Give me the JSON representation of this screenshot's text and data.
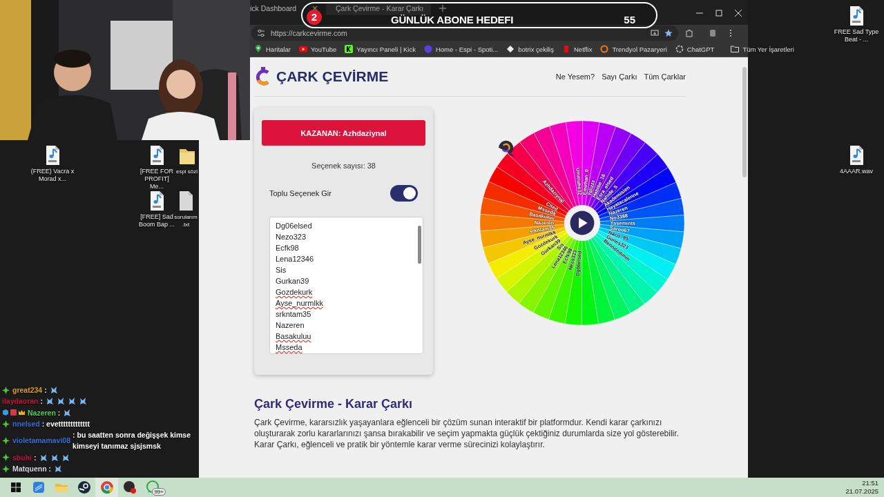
{
  "desktop_icons": [
    {
      "kind": "mp3",
      "label": "(FREE) Vacra x Morad x..."
    },
    {
      "kind": "mp3",
      "label": "[FREE FOR PROFIT] Me..."
    },
    {
      "kind": "folder",
      "label": "espi sözl"
    },
    {
      "kind": "mp3",
      "label": "[FREE] Sad Boom Bap ..."
    },
    {
      "kind": "txt",
      "label": "sorularım .txt"
    },
    {
      "kind": "mp3",
      "label": "FREE Sad Type Beat - ..."
    },
    {
      "kind": "wav",
      "label": "4AAAR.wav"
    }
  ],
  "browser": {
    "tabs": [
      {
        "title": "ick Dashboard",
        "selected": false
      },
      {
        "title": "Çark Çevirme - Karar Çarkı",
        "selected": true
      }
    ],
    "url": "https://carkcevirme.com",
    "bookmarks": [
      {
        "kind": "maps",
        "label": "Haritalar"
      },
      {
        "kind": "youtube",
        "label": "YouTube"
      },
      {
        "kind": "kick",
        "label": "Yayıncı Paneli | Kick"
      },
      {
        "kind": "spotify",
        "label": "Home - Espi - Spoti..."
      },
      {
        "kind": "botrix",
        "label": "botrix çekiliş"
      },
      {
        "kind": "netflix",
        "label": "Netflix"
      },
      {
        "kind": "trendyol",
        "label": "Trendyol Pazaryeri"
      },
      {
        "kind": "chatgpt",
        "label": "ChatGPT"
      }
    ],
    "all_bookmarks": "Tüm Yer İşaretleri",
    "page": {
      "site_title": "ÇARK ÇEVİRME",
      "nav": [
        "Ne Yesem?",
        "Sayı Çarkı",
        "Tüm Çarklar"
      ],
      "winner_button": "KAZANAN: Azhdaziynal",
      "option_count": "Seçenek sayısı: 38",
      "bulk_toggle": {
        "label": "Toplu Seçenek Gir",
        "on": true
      },
      "options": [
        {
          "text": "Dg06elsed",
          "spellcheck_error": false
        },
        {
          "text": "Nezo323",
          "spellcheck_error": false
        },
        {
          "text": "Ecfk98",
          "spellcheck_error": false
        },
        {
          "text": "Lena12346",
          "spellcheck_error": false
        },
        {
          "text": "Sis",
          "spellcheck_error": false
        },
        {
          "text": "Gurkan39",
          "spellcheck_error": false
        },
        {
          "text": "Gozdekurk",
          "spellcheck_error": true
        },
        {
          "text": "Ayse_nurmlkk",
          "spellcheck_error": true
        },
        {
          "text": "srkntam35",
          "spellcheck_error": false
        },
        {
          "text": "Nazeren",
          "spellcheck_error": false
        },
        {
          "text": "Basakuluu",
          "spellcheck_error": true
        },
        {
          "text": "Msseda",
          "spellcheck_error": true
        }
      ],
      "wheel": {
        "segments": [
          {
            "label": "Dg06elsed"
          },
          {
            "label": "Nezo323"
          },
          {
            "label": "Ecfk98"
          },
          {
            "label": "Lena12346"
          },
          {
            "label": "Sis"
          },
          {
            "label": "Gurkan39"
          },
          {
            "label": "Gozdekurk"
          },
          {
            "label": "Ayse_nurmlkk"
          },
          {
            "label": "srkntam35"
          },
          {
            "label": "Nazeren"
          },
          {
            "label": "Basakuluu"
          },
          {
            "label": "Msseda"
          },
          {
            "label": "Cited"
          },
          {
            "kind": "segment"
          },
          {
            "label": "Azhdaziynal"
          },
          {
            "kind": "segment"
          },
          {
            "kind": "segment"
          },
          {
            "kind": "segment"
          },
          {
            "label": "Ummuhe32"
          },
          {
            "label": "Emirhan_0"
          },
          {
            "label": "Yalizzz"
          },
          {
            "label": "Habibe_16"
          },
          {
            "label": "Esra_elsed"
          },
          {
            "label": "Nahide_5"
          },
          {
            "label": "Akademisien"
          },
          {
            "label": "Hayatacalenne"
          },
          {
            "label": "Nazeren"
          },
          {
            "label": "No3388"
          },
          {
            "label": "Yasemints"
          },
          {
            "label": "Saroo67"
          },
          {
            "label": "Naco_95"
          },
          {
            "label": "Gunes323"
          },
          {
            "label": "Benndedimm"
          },
          {
            "kind": "segment"
          },
          {
            "kind": "segment"
          },
          {
            "kind": "segment"
          },
          {
            "kind": "segment"
          },
          {
            "kind": "segment"
          }
        ]
      },
      "heading": "Çark Çevirme - Karar Çarkı",
      "paragraph": "Çark Çevirme, kararsızlık yaşayanlara eğlenceli bir çözüm sunan interaktif bir platformdur. Kendi karar çarkınızı oluşturarak zorlu kararlarınızı şansa bırakabilir ve seçim yapmakta güçlük çektiğiniz durumlarda size yol gösterebilir. Karar Çarkı, eğlenceli ve pratik bir yöntemle karar verme sürecinizi kolaylaştırır."
    }
  },
  "goal_overlay": {
    "badge": "2",
    "title": "GÜNLÜK ABONE HEDEFI",
    "count": "55"
  },
  "chat": [
    {
      "kind": "diamond",
      "user": "great234",
      "color": "#e0a020",
      "text": ":",
      "emotes": [
        {
          "kind": "emote"
        }
      ]
    },
    {
      "kind": "plain",
      "user": "ilaydaoran",
      "color": "#c8143c",
      "text": ":",
      "emotes": [
        {
          "kind": "emote"
        },
        {
          "kind": "emote"
        },
        {
          "kind": "emote"
        },
        {
          "kind": "emote"
        }
      ]
    },
    {
      "kind": "badges",
      "user": "Nazeren",
      "color": "#4fd14f",
      "text": ":",
      "emotes": [
        {
          "kind": "emote"
        }
      ]
    },
    {
      "kind": "diamond",
      "user": "nnelsed",
      "color": "#3a6fd8",
      "text": ": evettttttttttttt"
    },
    {
      "kind": "diamond",
      "user": "violetamamavi08",
      "color": "#3a6fd8",
      "text": ": bu saatten sonra değişşek kimse kimseyi tanımaz sjsjsmsk"
    },
    {
      "kind": "diamond",
      "user": "sbuhi",
      "color": "#c8143c",
      "text": ":",
      "emotes": [
        {
          "kind": "emote"
        },
        {
          "kind": "emote"
        },
        {
          "kind": "emote"
        }
      ]
    },
    {
      "kind": "diamond",
      "user": "Matquenn",
      "color": "#d8d8e8",
      "text": ":",
      "emotes": [
        {
          "kind": "emote"
        }
      ]
    }
  ],
  "taskbar": {
    "apps": [
      {
        "kind": "start",
        "active": false
      },
      {
        "kind": "app",
        "active": false
      },
      {
        "kind": "folder",
        "active": false
      },
      {
        "kind": "steam",
        "active": false
      },
      {
        "kind": "chrome",
        "active": true
      },
      {
        "kind": "recorder",
        "active": false
      },
      {
        "kind": "whatsapp",
        "active": false,
        "badge": "99+"
      }
    ],
    "time": "21:51",
    "date": "21.07.2025"
  }
}
